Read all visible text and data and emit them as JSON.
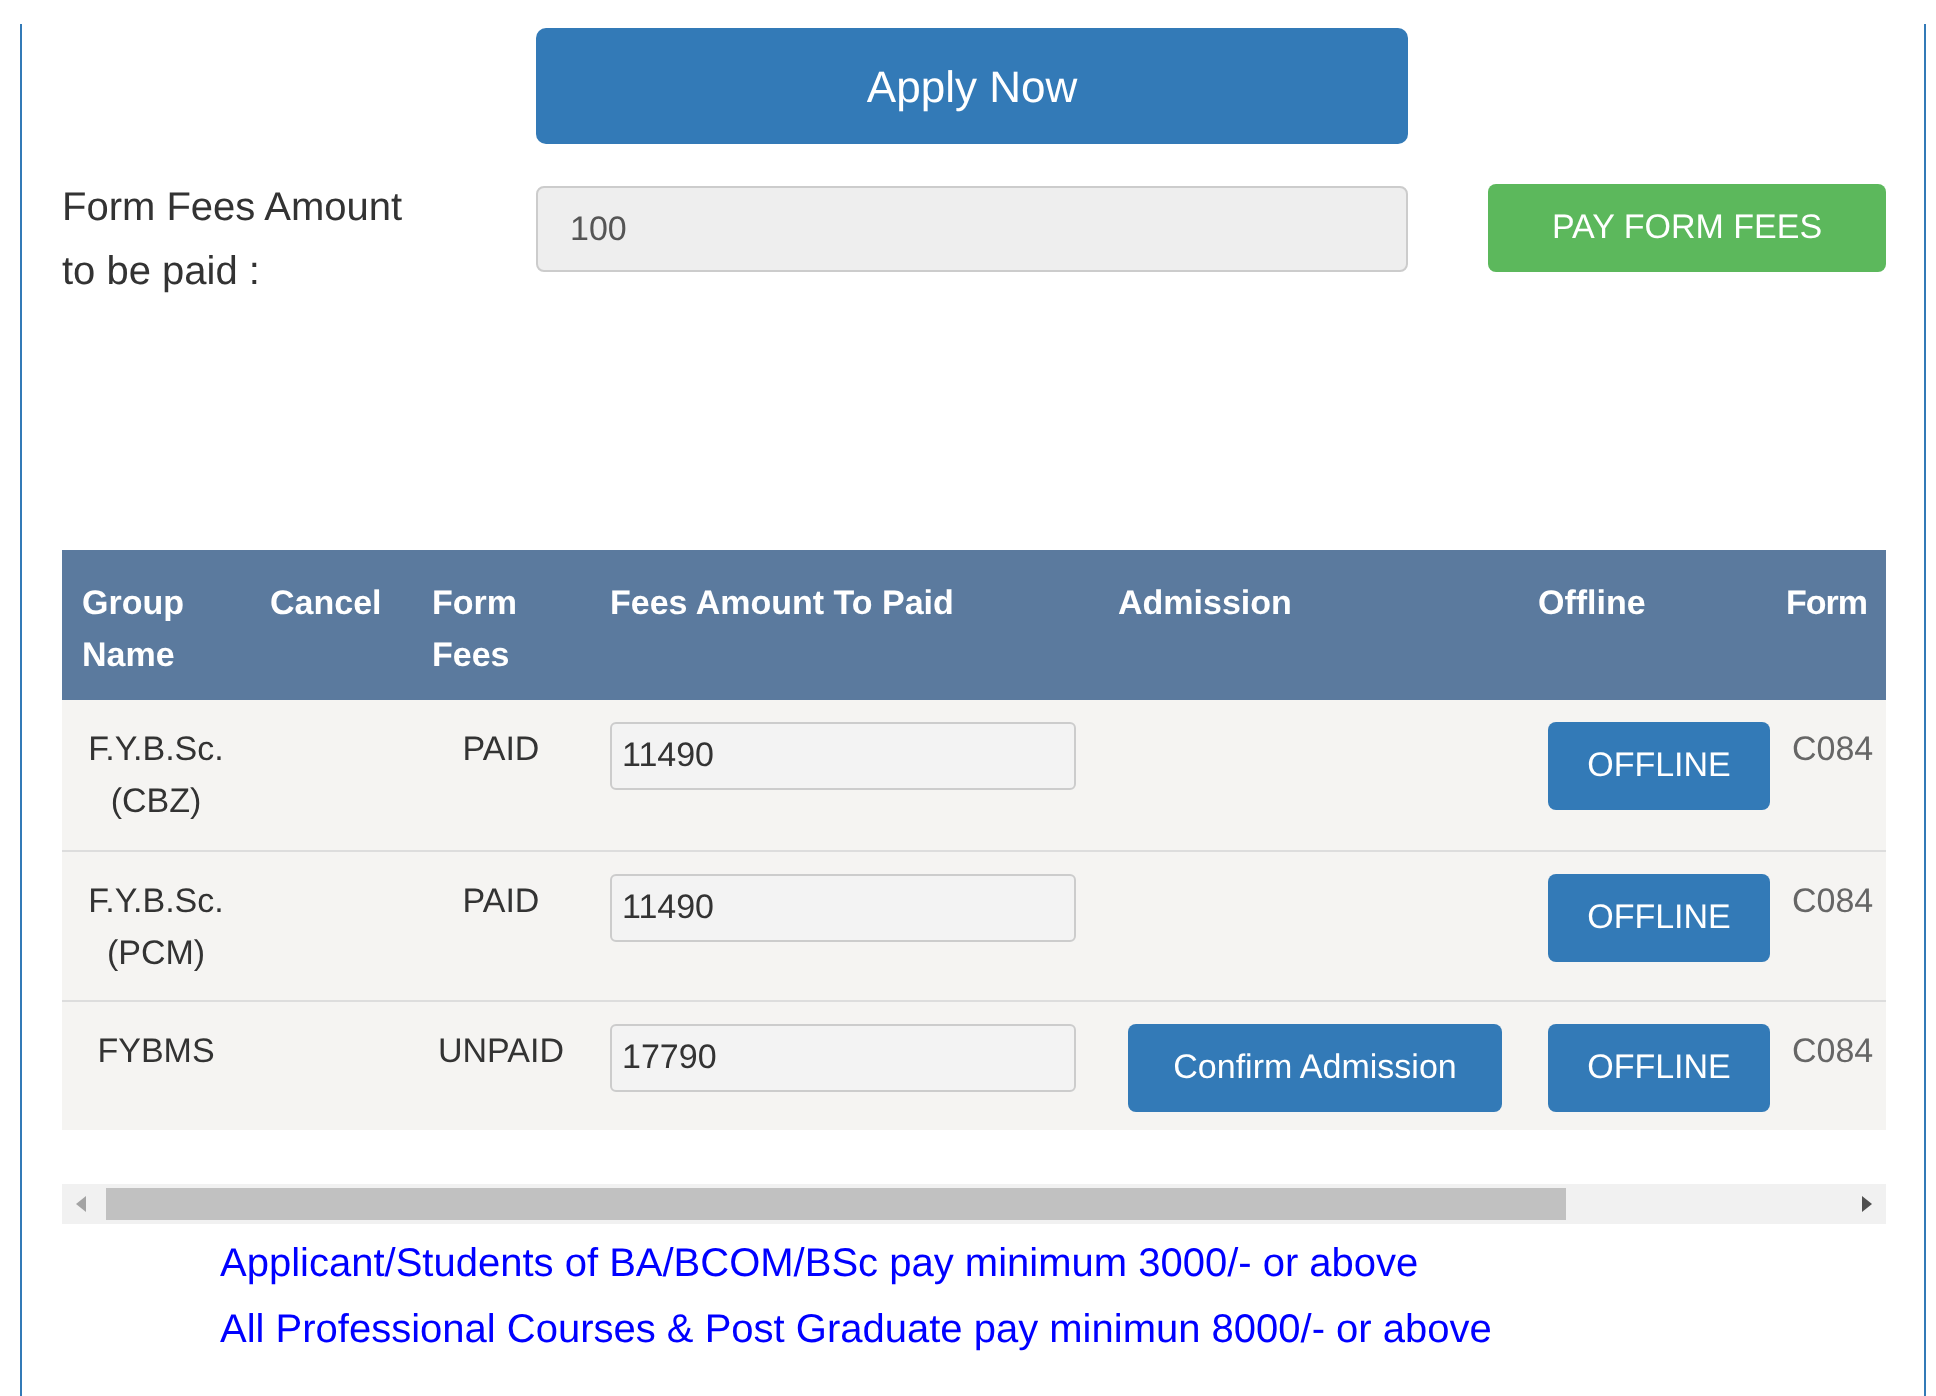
{
  "apply_button": "Apply Now",
  "form_fees": {
    "label": "Form Fees Amount to be paid :",
    "value": "100",
    "pay_button": "PAY FORM FEES"
  },
  "table": {
    "columns": [
      "Group Name",
      "Cancel",
      "Form Fees",
      "Fees Amount To Paid",
      "Admission",
      "Offline",
      "Form"
    ],
    "rows": [
      {
        "group_name": "F.Y.B.Sc. (CBZ)",
        "form_fees": "PAID",
        "fees_amount": "11490",
        "offline": "OFFLINE",
        "form": "C084"
      },
      {
        "group_name": "F.Y.B.Sc. (PCM)",
        "form_fees": "PAID",
        "fees_amount": "11490",
        "offline": "OFFLINE",
        "form": "C084"
      },
      {
        "group_name": "FYBMS",
        "form_fees": "UNPAID",
        "fees_amount": "17790",
        "admission": "Confirm Admission",
        "offline": "OFFLINE",
        "form": "C084"
      }
    ]
  },
  "notes": [
    "Applicant/Students of BA/BCOM/BSc pay minimum 3000/- or above",
    "All Professional Courses & Post Graduate pay minimun 8000/- or above"
  ]
}
